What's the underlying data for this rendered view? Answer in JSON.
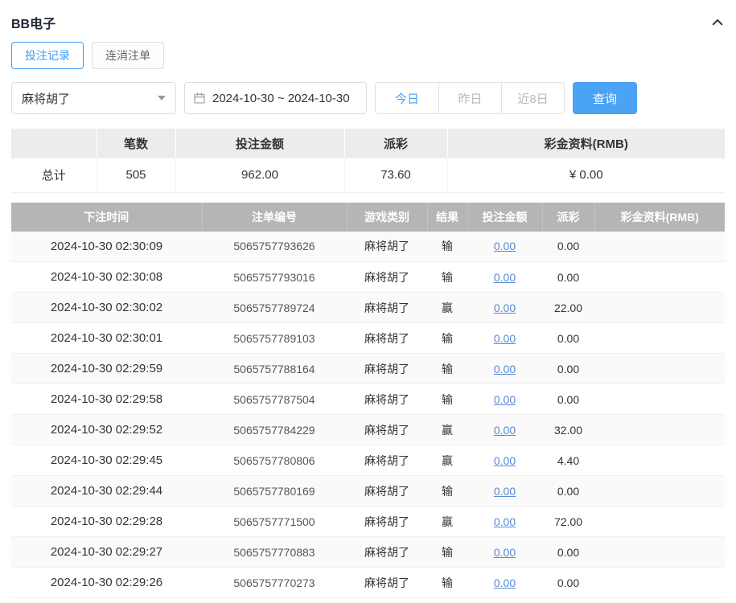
{
  "page": {
    "title": "BB电子"
  },
  "tabs": [
    {
      "label": "投注记录",
      "active": true
    },
    {
      "label": "连消注单",
      "active": false
    }
  ],
  "filters": {
    "game_select_value": "麻将胡了",
    "date_range": "2024-10-30 ~ 2024-10-30",
    "quick_buttons": [
      {
        "label": "今日",
        "active": true
      },
      {
        "label": "昨日",
        "active": false
      },
      {
        "label": "近8日",
        "active": false
      }
    ],
    "search_label": "查询"
  },
  "summary": {
    "headers": [
      "",
      "笔数",
      "投注金额",
      "派彩",
      "彩金资料(RMB)"
    ],
    "total": {
      "label": "总计",
      "count": "505",
      "bet_amount": "962.00",
      "payout": "73.60",
      "bonus": "¥ 0.00"
    }
  },
  "table": {
    "headers": [
      "下注时间",
      "注单编号",
      "游戏类别",
      "结果",
      "投注金额",
      "派彩",
      "彩金资料(RMB)"
    ],
    "rows": [
      {
        "time": "2024-10-30 02:30:09",
        "order_id": "5065757793626",
        "game": "麻将胡了",
        "result": "输",
        "bet": "0.00",
        "payout": "0.00",
        "bonus": ""
      },
      {
        "time": "2024-10-30 02:30:08",
        "order_id": "5065757793016",
        "game": "麻将胡了",
        "result": "输",
        "bet": "0.00",
        "payout": "0.00",
        "bonus": ""
      },
      {
        "time": "2024-10-30 02:30:02",
        "order_id": "5065757789724",
        "game": "麻将胡了",
        "result": "赢",
        "bet": "0.00",
        "payout": "22.00",
        "bonus": ""
      },
      {
        "time": "2024-10-30 02:30:01",
        "order_id": "5065757789103",
        "game": "麻将胡了",
        "result": "输",
        "bet": "0.00",
        "payout": "0.00",
        "bonus": ""
      },
      {
        "time": "2024-10-30 02:29:59",
        "order_id": "5065757788164",
        "game": "麻将胡了",
        "result": "输",
        "bet": "0.00",
        "payout": "0.00",
        "bonus": ""
      },
      {
        "time": "2024-10-30 02:29:58",
        "order_id": "5065757787504",
        "game": "麻将胡了",
        "result": "输",
        "bet": "0.00",
        "payout": "0.00",
        "bonus": ""
      },
      {
        "time": "2024-10-30 02:29:52",
        "order_id": "5065757784229",
        "game": "麻将胡了",
        "result": "赢",
        "bet": "0.00",
        "payout": "32.00",
        "bonus": ""
      },
      {
        "time": "2024-10-30 02:29:45",
        "order_id": "5065757780806",
        "game": "麻将胡了",
        "result": "赢",
        "bet": "0.00",
        "payout": "4.40",
        "bonus": ""
      },
      {
        "time": "2024-10-30 02:29:44",
        "order_id": "5065757780169",
        "game": "麻将胡了",
        "result": "输",
        "bet": "0.00",
        "payout": "0.00",
        "bonus": ""
      },
      {
        "time": "2024-10-30 02:29:28",
        "order_id": "5065757771500",
        "game": "麻将胡了",
        "result": "赢",
        "bet": "0.00",
        "payout": "72.00",
        "bonus": ""
      },
      {
        "time": "2024-10-30 02:29:27",
        "order_id": "5065757770883",
        "game": "麻将胡了",
        "result": "输",
        "bet": "0.00",
        "payout": "0.00",
        "bonus": ""
      },
      {
        "time": "2024-10-30 02:29:26",
        "order_id": "5065757770273",
        "game": "麻将胡了",
        "result": "输",
        "bet": "0.00",
        "payout": "0.00",
        "bonus": ""
      }
    ]
  },
  "colors": {
    "accent_blue": "#4aa3f5",
    "tab_active_blue": "#3d9df0",
    "link_blue": "#568ad4",
    "table_header_bg": "#b5b5b5",
    "summary_header_bg": "#ececec"
  }
}
